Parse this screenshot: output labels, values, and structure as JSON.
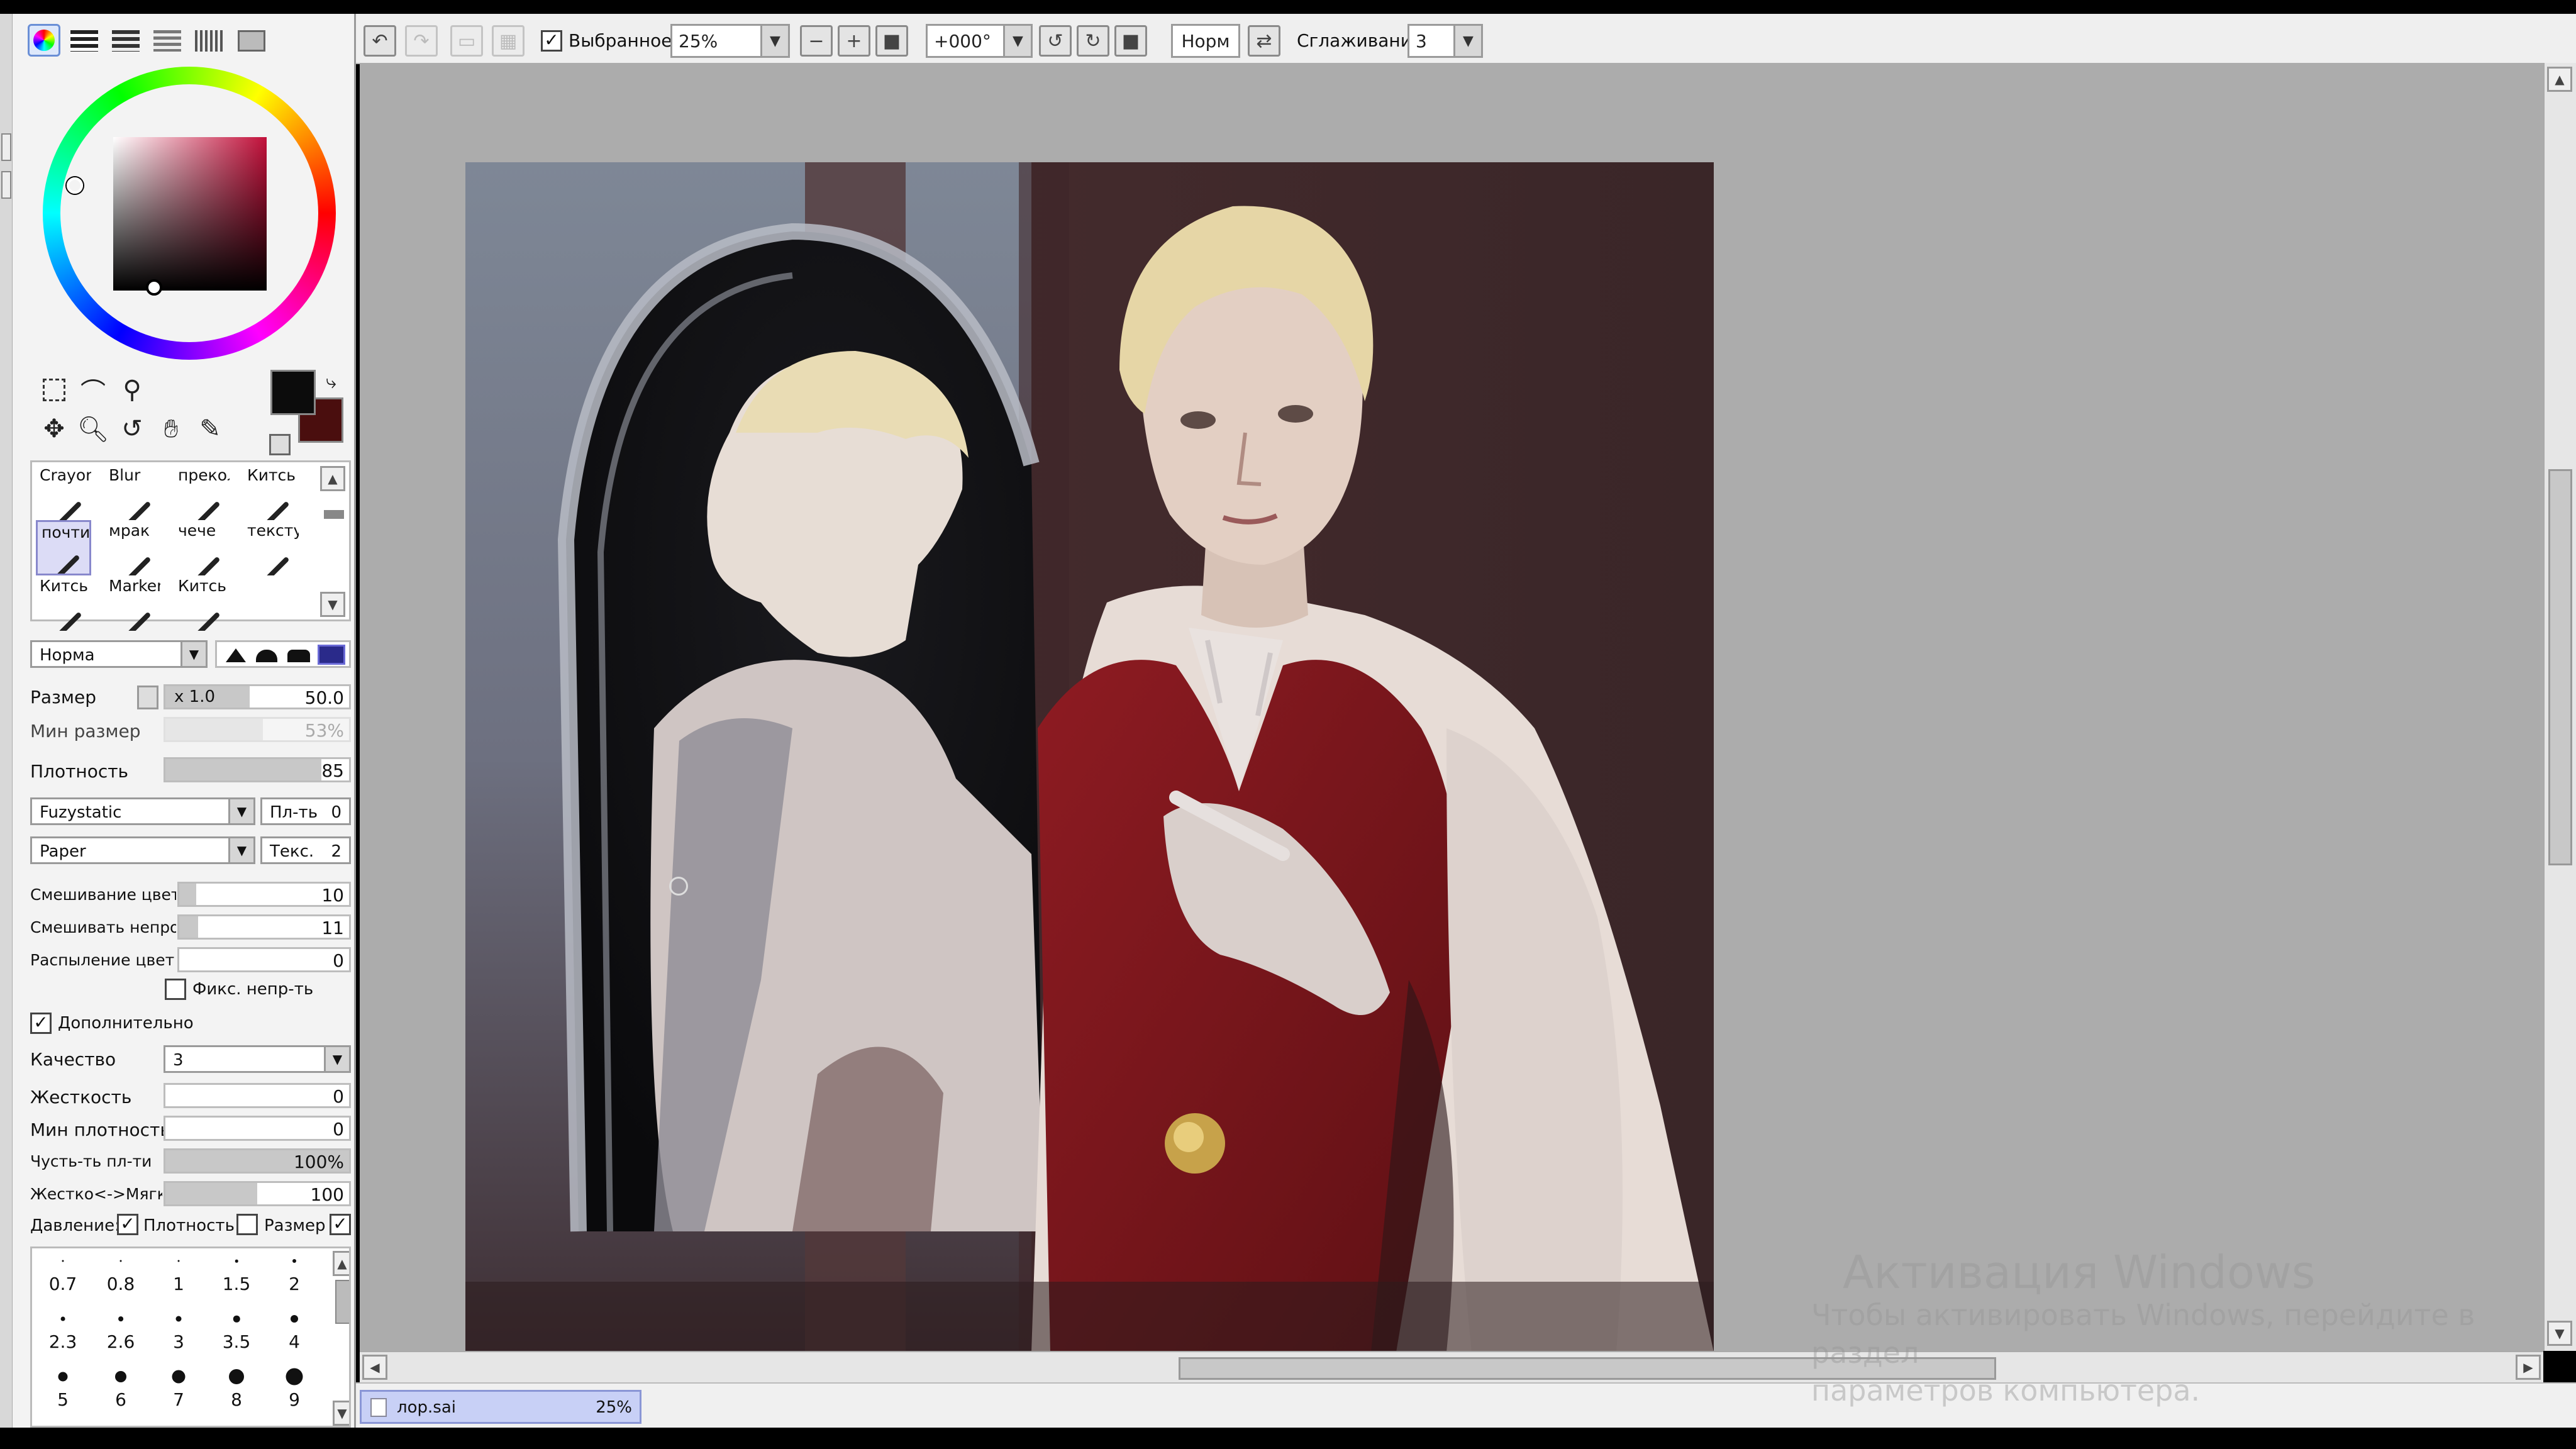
{
  "toolbar": {
    "favorites_checked": true,
    "favorites_label": "Выбранное",
    "zoom_value": "25%",
    "rotation_value": "+000°",
    "blend_mode_label": "Норм",
    "stabilizer_label": "Сглаживание",
    "stabilizer_value": "3"
  },
  "tools": {
    "primary_color": "#0c0c0c",
    "secondary_color": "#4a0e0e",
    "color_wheel_cursor_color": "#5a2b35"
  },
  "brushes": {
    "cells": [
      {
        "label": "Crayon"
      },
      {
        "label": "Blur"
      },
      {
        "label": "прекол"
      },
      {
        "label": "Китсь"
      },
      {
        "label": "почти"
      },
      {
        "label": "мрак"
      },
      {
        "label": "чече"
      },
      {
        "label": "текстур"
      },
      {
        "label": "Китсь"
      },
      {
        "label": "Marker"
      },
      {
        "label": "Китсь"
      }
    ],
    "selected_index": 4
  },
  "brush_settings": {
    "blend_mode": "Норма",
    "size": {
      "label": "Размер",
      "multiplier": "x 1.0",
      "value": "50.0"
    },
    "min_size": {
      "label": "Мин размер",
      "value": "53%"
    },
    "density": {
      "label": "Плотность",
      "value": "85"
    },
    "shape": {
      "value": "Fuzystatic",
      "param_label": "Пл-ть",
      "param_value": "0"
    },
    "texture": {
      "value": "Paper",
      "param_label": "Текс.",
      "param_value": "2"
    },
    "blend_color": {
      "label": "Смешивание цвет",
      "value": "10"
    },
    "blend_opacity": {
      "label": "Смешивать непрозр",
      "value": "11"
    },
    "spray_color": {
      "label": "Распыление цвет",
      "value": "0"
    },
    "fix_opacity": {
      "label": "Фикс. непр-ть",
      "checked": false
    },
    "advanced": {
      "label": "Дополнительно",
      "checked": true
    },
    "quality": {
      "label": "Качество",
      "value": "3"
    },
    "hardness": {
      "label": "Жесткость",
      "value": "0"
    },
    "min_density": {
      "label": "Мин плотность",
      "value": "0"
    },
    "pressure_sensitivity": {
      "label": "Чусть-ть пл-ти",
      "value": "100%"
    },
    "hard_soft": {
      "label": "Жестко<->Мягко",
      "value": "100"
    },
    "pressure": {
      "label": "Давление:",
      "density_checked": true,
      "density_label": "Плотность",
      "size_checked": false,
      "size_label": "Размер",
      "extra_checked": true
    }
  },
  "size_presets": [
    "0.7",
    "0.8",
    "1",
    "1.5",
    "2",
    "2.3",
    "2.6",
    "3",
    "3.5",
    "4",
    "5",
    "6",
    "7",
    "8",
    "9"
  ],
  "status": {
    "filename": "лор.sai",
    "zoom": "25%"
  },
  "watermark": {
    "line1": "Активация Windows",
    "line2": "Чтобы активировать Windows, перейдите в раздел",
    "line3": "параметров компьютера."
  }
}
